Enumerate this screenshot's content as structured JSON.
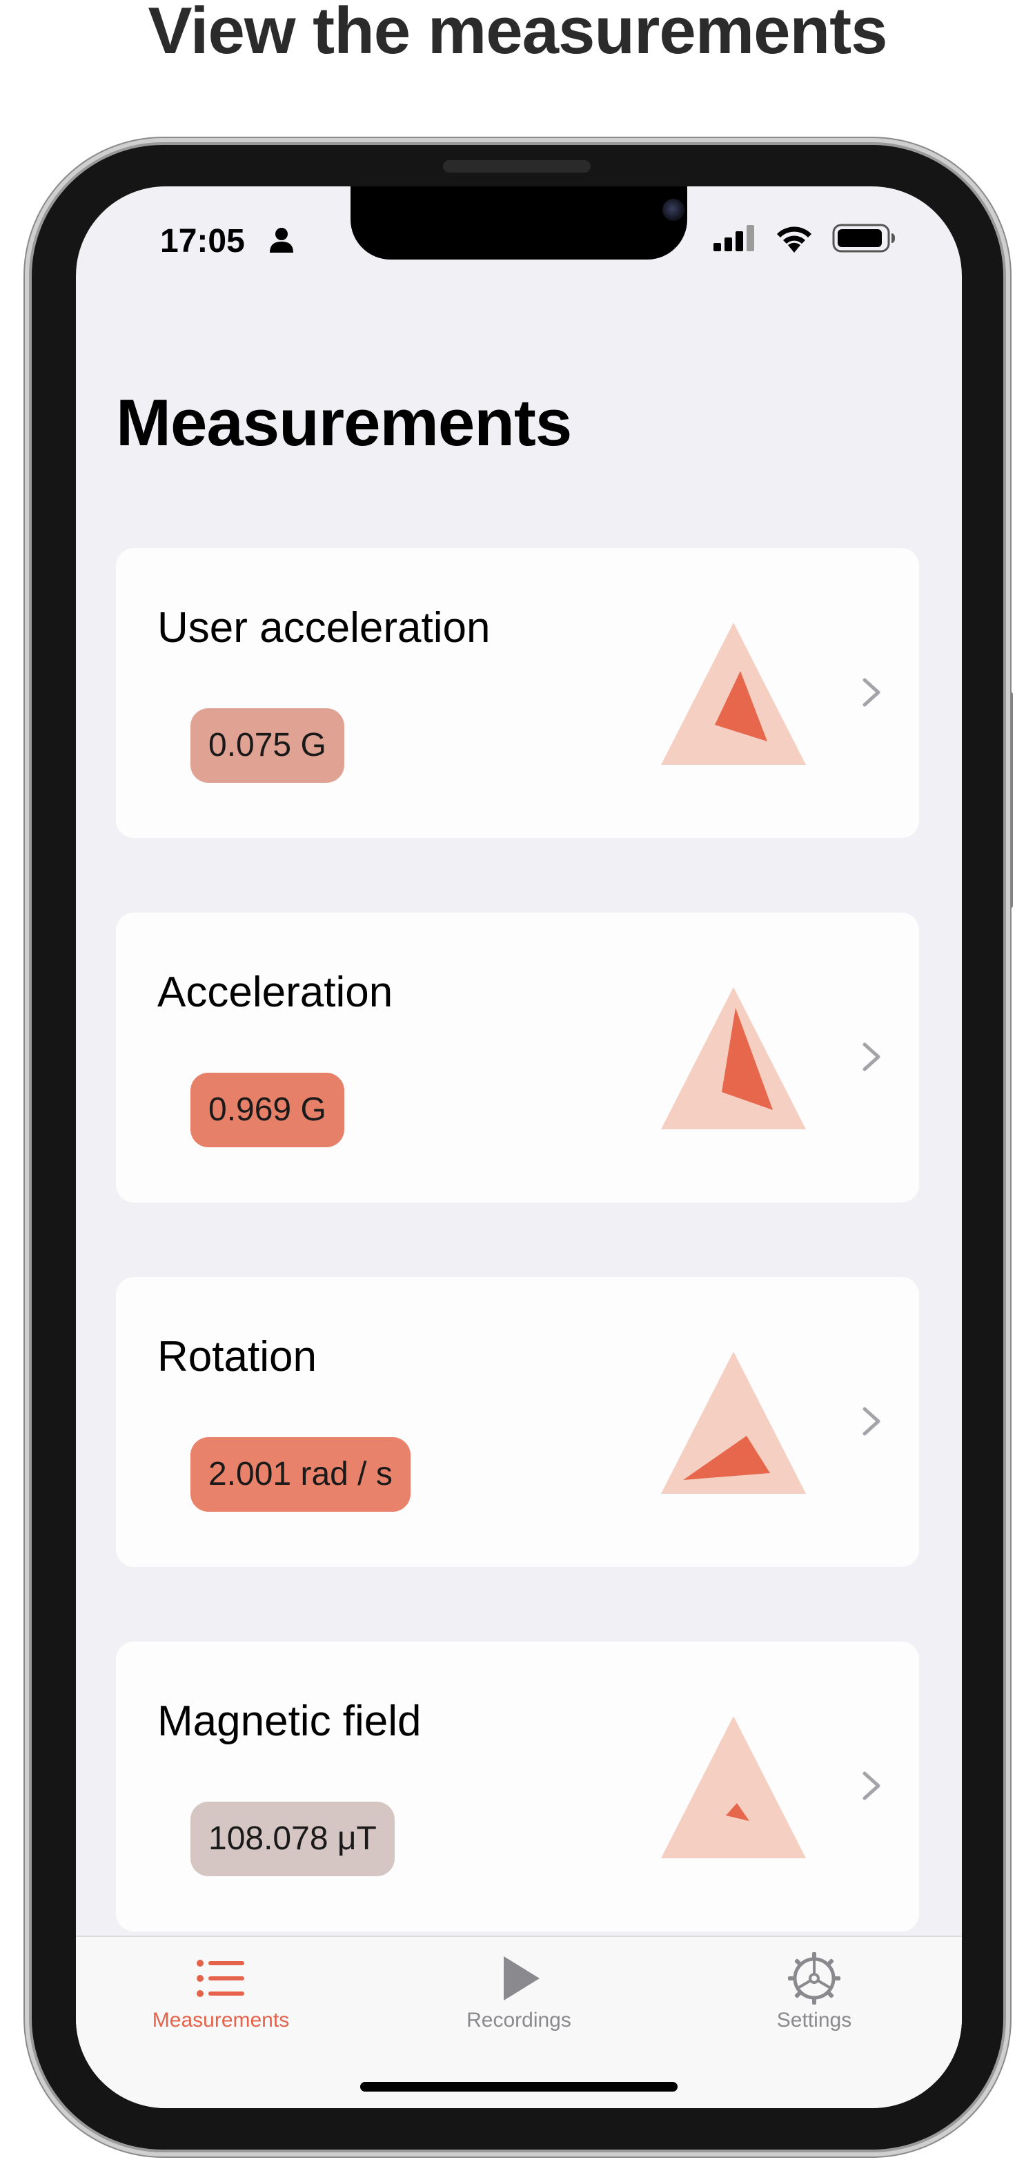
{
  "headline": "View the measurements",
  "status_bar": {
    "time": "17:05"
  },
  "page": {
    "title": "Measurements"
  },
  "measurements": [
    {
      "label": "User acceleration",
      "value": "0.075 G",
      "badge_color": "#e0a292"
    },
    {
      "label": "Acceleration",
      "value": "0.969 G",
      "badge_color": "#e78068"
    },
    {
      "label": "Rotation",
      "value": "2.001 rad / s",
      "badge_color": "#e9826a"
    },
    {
      "label": "Magnetic field",
      "value": "108.078 μT",
      "badge_color": "#d6c6c3"
    }
  ],
  "tabs": [
    {
      "label": "Measurements",
      "icon": "list-icon",
      "active": true
    },
    {
      "label": "Recordings",
      "icon": "play-icon",
      "active": false
    },
    {
      "label": "Settings",
      "icon": "gear-icon",
      "active": false
    }
  ],
  "colors": {
    "accent": "#e4634a",
    "triangle_light": "#f6cfc3",
    "triangle_dark": "#e6674c",
    "tab_inactive": "#8a8a8e",
    "background": "#f0f0f5",
    "card": "#fdfdfd"
  }
}
